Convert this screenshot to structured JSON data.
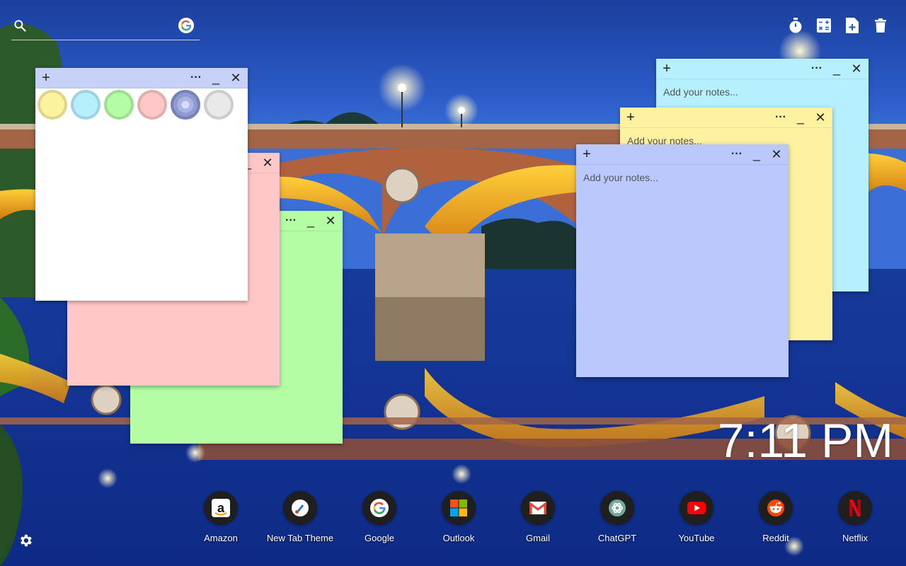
{
  "search": {
    "placeholder": "",
    "engine_icon": "google-icon"
  },
  "toolbar": {
    "buttons": [
      "timer-icon",
      "calculator-icon",
      "new-note-icon",
      "trash-icon"
    ]
  },
  "notes": {
    "white": {
      "color": "#ffffff",
      "plus": "+",
      "dots": "···",
      "min": "_",
      "close": "✕"
    },
    "pink": {
      "color": "#ffc7c7",
      "close": "✕",
      "min": "_"
    },
    "green": {
      "color": "#b4fda4",
      "dots": "···",
      "min": "_",
      "close": "✕"
    },
    "cyan": {
      "color": "#b6f0ff",
      "plus": "+",
      "dots": "···",
      "min": "_",
      "close": "✕",
      "placeholder": "Add your notes..."
    },
    "yellow": {
      "color": "#fdf29f",
      "plus": "+",
      "dots": "···",
      "min": "_",
      "close": "✕",
      "placeholder": "Add your notes..."
    },
    "blue": {
      "color": "#bbc8fb",
      "plus": "+",
      "dots": "···",
      "min": "_",
      "close": "✕",
      "placeholder": "Add your notes..."
    }
  },
  "color_picker": [
    {
      "name": "yellow",
      "color": "#fdf29f"
    },
    {
      "name": "cyan",
      "color": "#b6f0ff"
    },
    {
      "name": "green",
      "color": "#b4fda4"
    },
    {
      "name": "pink",
      "color": "#ffc7c7"
    },
    {
      "name": "blue",
      "color": "#8f9bcf",
      "selected": true
    },
    {
      "name": "gray",
      "color": "#e9e9e9"
    }
  ],
  "clock": {
    "time": "7:11 PM"
  },
  "shortcuts": [
    {
      "label": "Amazon",
      "icon": "amazon-icon"
    },
    {
      "label": "New Tab Theme",
      "icon": "new-tab-theme-icon"
    },
    {
      "label": "Google",
      "icon": "google-icon"
    },
    {
      "label": "Outlook",
      "icon": "outlook-icon"
    },
    {
      "label": "Gmail",
      "icon": "gmail-icon"
    },
    {
      "label": "ChatGPT",
      "icon": "chatgpt-icon"
    },
    {
      "label": "YouTube",
      "icon": "youtube-icon"
    },
    {
      "label": "Reddit",
      "icon": "reddit-icon"
    },
    {
      "label": "Netflix",
      "icon": "netflix-icon"
    }
  ]
}
